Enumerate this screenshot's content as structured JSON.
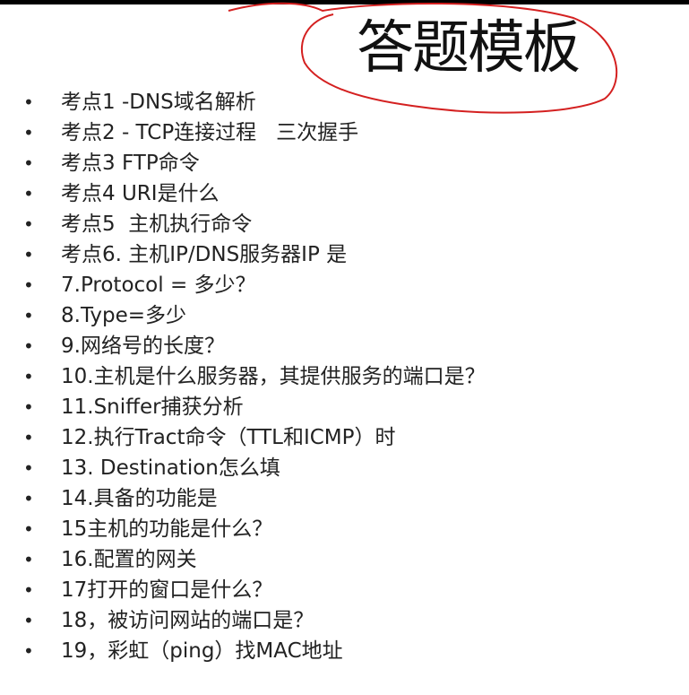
{
  "title": "答题模板",
  "items": [
    "考点1 -DNS域名解析",
    "考点2 - TCP连接过程   三次握手",
    "考点3 FTP命令",
    "考点4 URI是什么",
    "考点5  主机执行命令",
    "考点6. 主机IP/DNS服务器IP 是",
    "7.Protocol = 多少？",
    "8.Type=多少",
    "9.网络号的长度？",
    "10.主机是什么服务器，其提供服务的端口是？",
    "11.Sniffer捕获分析",
    "12.执行Tract命令（TTL和ICMP）时",
    "13. Destination怎么填",
    "14.具备的功能是",
    "15主机的功能是什么？",
    "16.配置的网关",
    "17打开的窗口是什么？",
    "18，被访问网站的端口是？",
    "19，彩虹（ping）找MAC地址"
  ],
  "bullet": "•",
  "annotation_color": "#d42020"
}
